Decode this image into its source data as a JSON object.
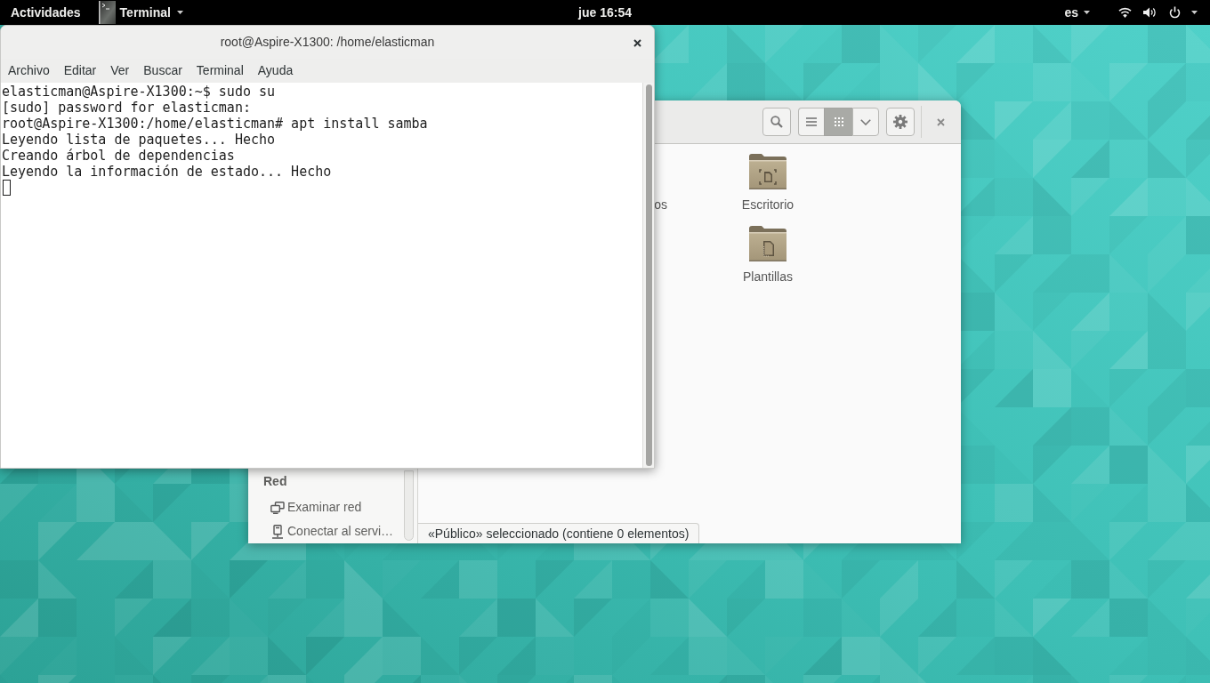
{
  "top_bar": {
    "activities": "Actividades",
    "app_menu": "Terminal",
    "clock": "jue 16:54",
    "input_source": "es"
  },
  "terminal_window": {
    "title": "root@Aspire-X1300: /home/elasticman",
    "menu": [
      "Archivo",
      "Editar",
      "Ver",
      "Buscar",
      "Terminal",
      "Ayuda"
    ],
    "lines": [
      "elasticman@Aspire-X1300:~$ sudo su",
      "[sudo] password for elasticman:",
      "root@Aspire-X1300:/home/elasticman# apt install samba",
      "Leyendo lista de paquetes... Hecho",
      "Creando árbol de dependencias",
      "Leyendo la información de estado... Hecho"
    ]
  },
  "files_window": {
    "view_buttons": [
      {
        "kind": "list",
        "selected": false
      },
      {
        "kind": "grid",
        "selected": true
      }
    ],
    "icon_view": {
      "cut_off_label": "os",
      "items": [
        {
          "label": "Escritorio",
          "kind": "desktop"
        },
        {
          "label": "Plantillas",
          "kind": "templates"
        }
      ]
    },
    "sidebar": {
      "sections": [
        {
          "heading": "Red",
          "items": [
            {
              "label": "Examinar red",
              "kind": "network"
            },
            {
              "label": "Conectar al servi…",
              "kind": "server"
            }
          ]
        }
      ]
    },
    "status": "«Público» seleccionado (contiene 0 elementos)"
  }
}
